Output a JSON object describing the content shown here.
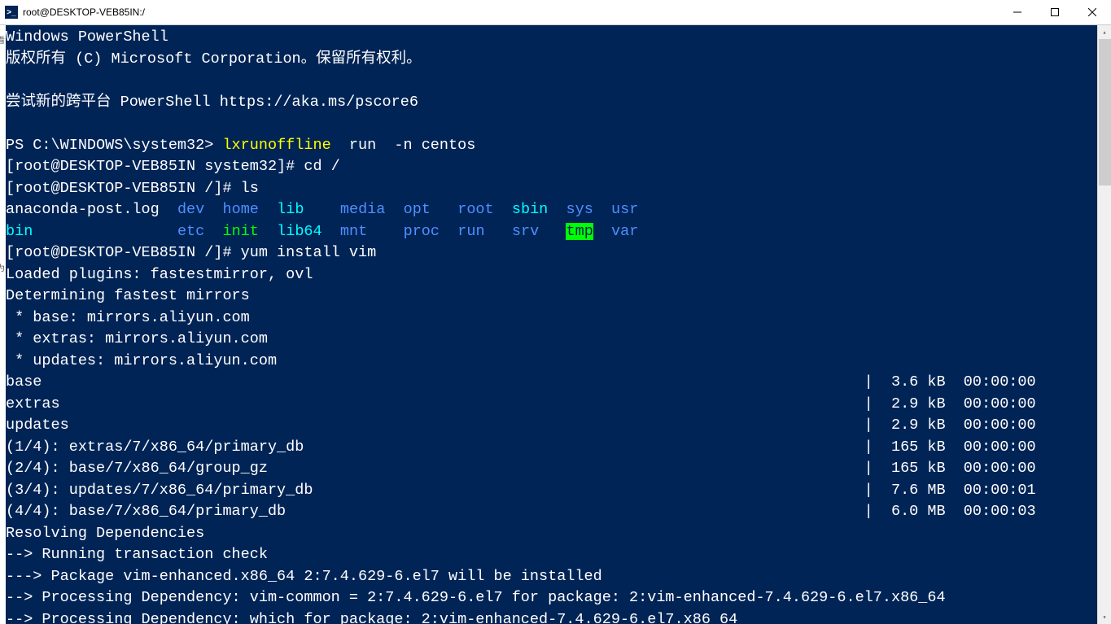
{
  "window": {
    "title": "root@DESKTOP-VEB85IN:/"
  },
  "left_edge": {
    "char1": "看",
    "char2": "为"
  },
  "intro": {
    "line1": "Windows PowerShell",
    "line2": "版权所有 (C) Microsoft Corporation。保留所有权利。",
    "line3": "尝试新的跨平台 PowerShell https://aka.ms/pscore6"
  },
  "prompt1": {
    "ps": "PS C:\\WINDOWS\\system32> ",
    "cmd_part1": "lxrunoffline ",
    "cmd_part2": " run  -n ",
    "cmd_part3": "centos"
  },
  "prompt2": {
    "prompt": "[root@DESKTOP-VEB85IN system32]# cd /"
  },
  "prompt3": {
    "prompt": "[root@DESKTOP-VEB85IN /]# ls"
  },
  "ls": {
    "col1": {
      "a": "anaconda-post.log",
      "b": "bin"
    },
    "col2": {
      "a": "dev",
      "b": "etc"
    },
    "col3": {
      "a": "home",
      "b": "init"
    },
    "col4": {
      "a": "lib",
      "b": "lib64"
    },
    "col5": {
      "a": "media",
      "b": "mnt"
    },
    "col6": {
      "a": "opt",
      "b": "proc"
    },
    "col7": {
      "a": "root",
      "b": "run"
    },
    "col8": {
      "a": "sbin",
      "b": "srv"
    },
    "col9": {
      "a": "sys",
      "b": "tmp"
    },
    "col10": {
      "a": "usr",
      "b": "var"
    }
  },
  "prompt4": {
    "prompt": "[root@DESKTOP-VEB85IN /]# yum install vim"
  },
  "yum": {
    "l1": "Loaded plugins: fastestmirror, ovl",
    "l2": "Determining fastest mirrors",
    "l3": " * base: mirrors.aliyun.com",
    "l4": " * extras: mirrors.aliyun.com",
    "l5": " * updates: mirrors.aliyun.com",
    "rows": [
      {
        "name": "base",
        "size": "3.6 kB",
        "time": "00:00:00"
      },
      {
        "name": "extras",
        "size": "2.9 kB",
        "time": "00:00:00"
      },
      {
        "name": "updates",
        "size": "2.9 kB",
        "time": "00:00:00"
      },
      {
        "name": "(1/4): extras/7/x86_64/primary_db",
        "size": "165 kB",
        "time": "00:00:00"
      },
      {
        "name": "(2/4): base/7/x86_64/group_gz",
        "size": "165 kB",
        "time": "00:00:00"
      },
      {
        "name": "(3/4): updates/7/x86_64/primary_db",
        "size": "7.6 MB",
        "time": "00:00:01"
      },
      {
        "name": "(4/4): base/7/x86_64/primary_db",
        "size": "6.0 MB",
        "time": "00:00:03"
      }
    ],
    "l13": "Resolving Dependencies",
    "l14": "--> Running transaction check",
    "l15": "---> Package vim-enhanced.x86_64 2:7.4.629-6.el7 will be installed",
    "l16": "--> Processing Dependency: vim-common = 2:7.4.629-6.el7 for package: 2:vim-enhanced-7.4.629-6.el7.x86_64",
    "l17": "--> Processing Dependency: which for package: 2:vim-enhanced-7.4.629-6.el7.x86_64"
  }
}
